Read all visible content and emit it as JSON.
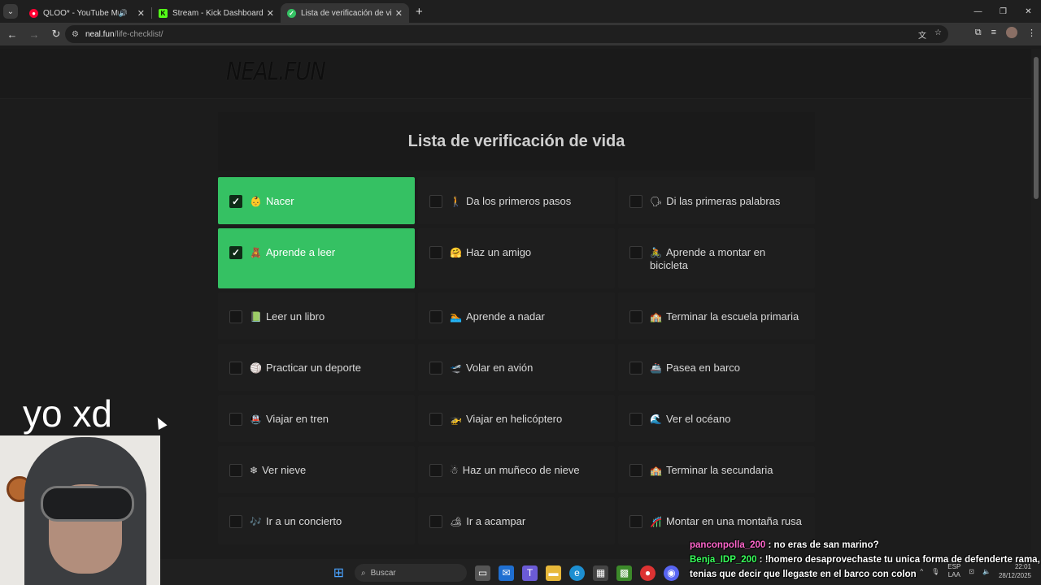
{
  "browser": {
    "tabs": [
      {
        "title": "QLOO* - YouTube Music",
        "favicon_color": "#ff0033",
        "active": false,
        "audio": true
      },
      {
        "title": "Stream - Kick Dashboard",
        "favicon_color": "#53fc18",
        "active": false,
        "audio": false
      },
      {
        "title": "Lista de verificación de vida",
        "favicon_color": "#35c163",
        "active": true,
        "audio": false
      }
    ],
    "url_host": "neal.fun",
    "url_path": "/life-checklist/"
  },
  "site": {
    "logo": "NEAL.FUN",
    "title": "Lista de verificación de vida"
  },
  "checklist": [
    {
      "emoji": "👶",
      "label": "Nacer",
      "checked": true
    },
    {
      "emoji": "🚶",
      "label": "Da los primeros pasos",
      "checked": false
    },
    {
      "emoji": "🗣",
      "label": "Di las primeras palabras",
      "checked": false
    },
    {
      "emoji": "🧸",
      "label": "Aprende a leer",
      "checked": true
    },
    {
      "emoji": "🤗",
      "label": "Haz un amigo",
      "checked": false
    },
    {
      "emoji": "🚴",
      "label": "Aprende a montar en bicicleta",
      "checked": false
    },
    {
      "emoji": "📗",
      "label": "Leer un libro",
      "checked": false
    },
    {
      "emoji": "🏊",
      "label": "Aprende a nadar",
      "checked": false
    },
    {
      "emoji": "🏫",
      "label": "Terminar la escuela primaria",
      "checked": false
    },
    {
      "emoji": "🏐",
      "label": "Practicar un deporte",
      "checked": false
    },
    {
      "emoji": "🛫",
      "label": "Volar en avión",
      "checked": false
    },
    {
      "emoji": "🚢",
      "label": "Pasea en barco",
      "checked": false
    },
    {
      "emoji": "🚇",
      "label": "Viajar en tren",
      "checked": false
    },
    {
      "emoji": "🚁",
      "label": "Viajar en helicóptero",
      "checked": false
    },
    {
      "emoji": "🌊",
      "label": "Ver el océano",
      "checked": false
    },
    {
      "emoji": "❄",
      "label": "Ver nieve",
      "checked": false
    },
    {
      "emoji": "☃",
      "label": "Haz un muñeco de nieve",
      "checked": false
    },
    {
      "emoji": "🏫",
      "label": "Terminar la secundaria",
      "checked": false
    },
    {
      "emoji": "🎶",
      "label": "Ir a un concierto",
      "checked": false
    },
    {
      "emoji": "🏕",
      "label": "Ir a acampar",
      "checked": false
    },
    {
      "emoji": "🎢",
      "label": "Montar en una montaña rusa",
      "checked": false
    }
  ],
  "overlay": {
    "webcam_label": "yo xd",
    "chat": [
      {
        "user": "panconpolla_200",
        "message": ": no eras de san marino?"
      },
      {
        "user": "Benja_IDP_200",
        "message": ": !homero desaprovechaste tu unica forma de defenderte rama, tenias que decir que llegaste en el barco con colon"
      }
    ]
  },
  "taskbar": {
    "search_placeholder": "Buscar",
    "lang_top": "ESP",
    "lang_bottom": "LAA",
    "time": "22:01",
    "date": "28/12/2025"
  }
}
